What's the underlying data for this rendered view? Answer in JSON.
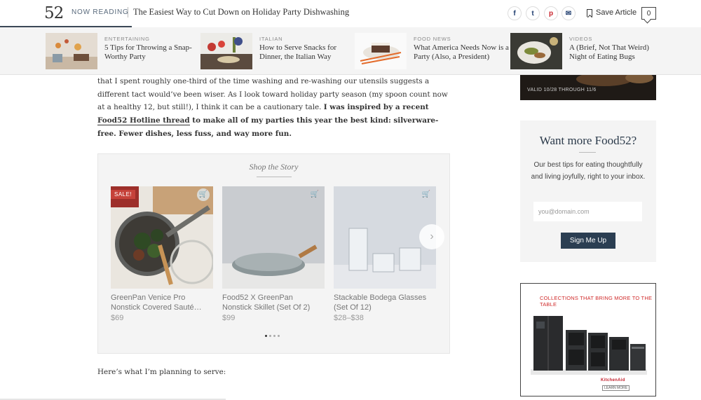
{
  "header": {
    "logo": "52",
    "now_reading_label": "NOW READING",
    "headline": "The Easiest Way to Cut Down on Holiday Party Dishwashing",
    "social": {
      "facebook": "f",
      "twitter": "t",
      "pinterest": "p",
      "email": "✉"
    },
    "save_label": "Save Article",
    "comment_count": "0"
  },
  "related": [
    {
      "category": "ENTERTAINING",
      "title": "5 Tips for Throwing a Snap-Worthy Party"
    },
    {
      "category": "ITALIAN",
      "title": "How to Serve Snacks for Dinner, the Italian Way"
    },
    {
      "category": "FOOD NEWS",
      "title": "What America Needs Now is a Party (Also, a President)"
    },
    {
      "category": "VIDEOS",
      "title": "A (Brief, Not That Weird) Night of Eating Bugs"
    }
  ],
  "article": {
    "p1_normal": "that I spent roughly one-third of the time washing and re-washing our utensils suggests a different tact would’ve been wiser. As I look toward holiday party season (my spoon count now at a healthy 12, but still!), I think it can be a cautionary tale. ",
    "p1_bold_start": "I was inspired by a recent ",
    "p1_bold_link": "Food52 Hotline thread",
    "p1_bold_end": " to make all of my parties this year the best kind: silverware-free. Fewer dishes, less fuss, and way more fun.",
    "p2": "Here’s what I’m planning to serve:"
  },
  "shop": {
    "title": "Shop the Story",
    "sale_badge": "SALE!",
    "products": [
      {
        "name": "GreenPan Venice Pro Nonstick Covered Sauté…",
        "price": "$69"
      },
      {
        "name": "Food52 X GreenPan Nonstick Skillet (Set Of 2)",
        "price": "$99"
      },
      {
        "name": "Stackable Bodega Glasses (Set Of 12)",
        "price": "$28–$38"
      }
    ],
    "next_arrow": "›",
    "carousel_pages": 4,
    "carousel_active": 1
  },
  "sidebar": {
    "top_ad_text": "VALID 10/28 THROUGH 11/6",
    "newsletter": {
      "title": "Want more Food52?",
      "copy": "Our best tips for eating thoughtfully and living joyfully, right to your inbox.",
      "placeholder": "you@domain.com",
      "button": "Sign Me Up"
    },
    "ad": {
      "headline": "COLLECTIONS THAT BRING MORE TO THE TABLE",
      "brand": "KitchenAid",
      "cta": "LEARN MORE"
    }
  },
  "colors": {
    "accent_navy": "#2b3e52",
    "sale_red": "#c6423a",
    "ad_red": "#d02b2b"
  }
}
